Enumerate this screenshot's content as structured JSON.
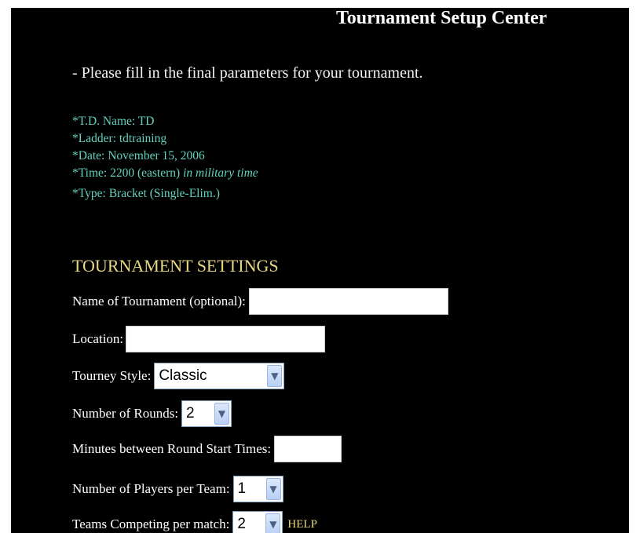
{
  "header": {
    "title": "Tournament Setup Center"
  },
  "intro": "- Please fill in the final parameters for your tournament.",
  "info": {
    "td_name": "*T.D. Name: TD",
    "ladder": "*Ladder: tdtraining",
    "date": "*Date: November 15, 2006",
    "time": "*Time: 2200 (eastern)",
    "time_note": "in military time",
    "type": "*Type: Bracket (Single-Elim.)"
  },
  "settings": {
    "heading": "TOURNAMENT SETTINGS",
    "name_label": "Name of Tournament (optional):",
    "name_value": "",
    "location_label": "Location:",
    "location_value": "",
    "style_label": "Tourney Style:",
    "style_value": "Classic",
    "rounds_label": "Number of Rounds:",
    "rounds_value": "2",
    "minutes_label": "Minutes between Round Start Times:",
    "minutes_value": "",
    "players_label": "Number of Players per Team:",
    "players_value": "1",
    "teams_label": "Teams Competing per match:",
    "teams_value": "2",
    "help_label": "HELP"
  },
  "colors": {
    "info_text": "#63d1bd",
    "heading": "#e8d884",
    "background": "#000000"
  }
}
